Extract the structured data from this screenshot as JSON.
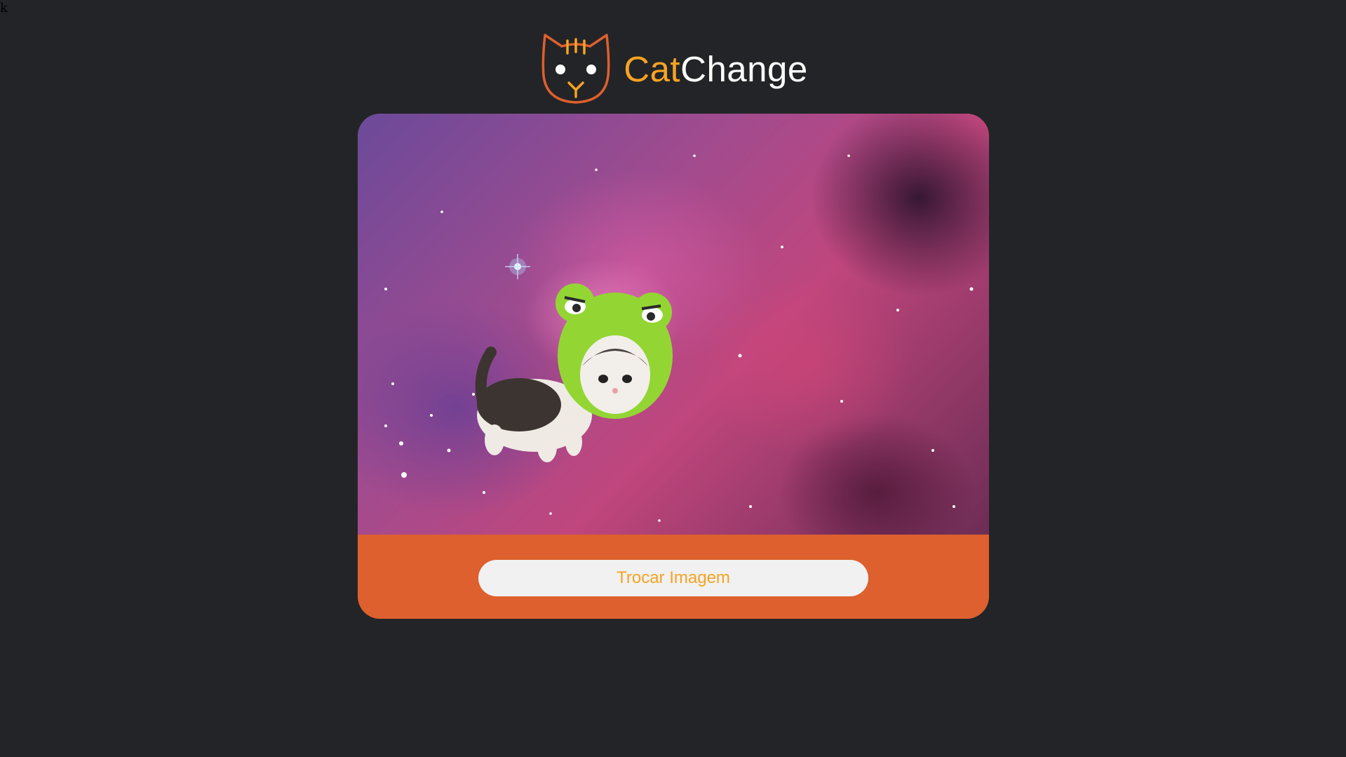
{
  "page": {
    "stray_text": "k",
    "background_color": "#232427"
  },
  "header": {
    "logo_icon": "cat-face-icon",
    "brand_part1": "Cat",
    "brand_part2": "Change",
    "brand_color_accent": "#f6a323",
    "brand_color_main": "#ffffff"
  },
  "card": {
    "image_description_icon": "space-kitten-frog-hat-image",
    "button_bar_color": "#dd602e",
    "swap_button_label": "Trocar Imagem",
    "swap_button_text_color": "#f6a323",
    "swap_button_bg": "#f1f1f1"
  }
}
